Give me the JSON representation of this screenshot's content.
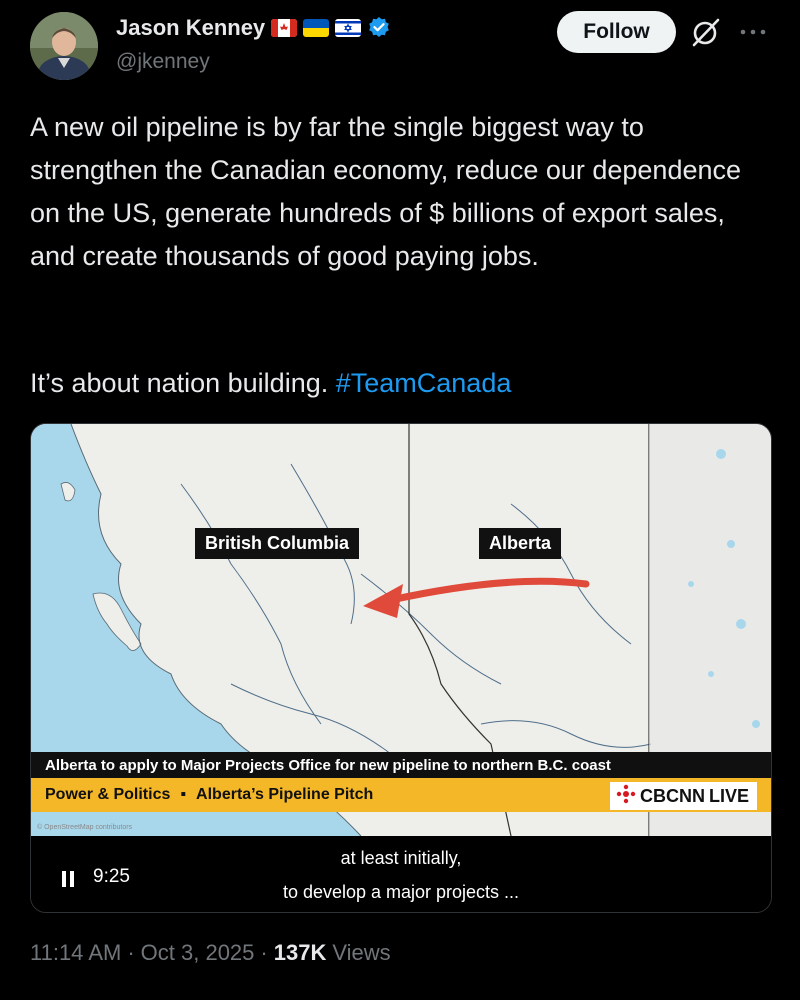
{
  "author": {
    "name": "Jason Kenney",
    "handle": "@jkenney",
    "flags": [
      "canada-flag",
      "ukraine-flag",
      "israel-flag"
    ],
    "verified_icon": "verified-badge-icon"
  },
  "actions": {
    "follow_label": "Follow",
    "grok_icon": "grok-icon",
    "more_icon": "more-icon"
  },
  "tweet": {
    "text": "A new oil pipeline is by far the single biggest way to strengthen the Canadian economy, reduce our dependence on the US, generate hundreds of $ billions of export sales, and create thousands of good paying jobs.",
    "line2_prefix": "It’s about nation building. ",
    "hashtag": "#TeamCanada"
  },
  "media": {
    "map_labels": {
      "bc": "British Columbia",
      "alberta": "Alberta"
    },
    "headline": "Alberta to apply to Major Projects Office for new pipeline to northern B.C. coast",
    "ticker_show": "Power & Politics",
    "ticker_separator": "▪",
    "ticker_topic": "Alberta’s Pipeline Pitch",
    "network": "CBCNN",
    "live": "LIVE",
    "osm_credit": "© OpenStreetMap contributors",
    "player": {
      "state_icon": "pause-icon",
      "time": "9:25"
    },
    "captions": [
      "at least initially,",
      "to develop a major projects ..."
    ]
  },
  "meta": {
    "time": "11:14 AM",
    "sep1": "·",
    "date": "Oct 3, 2025",
    "sep2": "·",
    "views_count": "137K",
    "views_label": "Views"
  },
  "colors": {
    "background": "#000000",
    "link": "#1d9bf0",
    "secondary_text": "#71767b",
    "ticker_yellow": "#f4b728",
    "cbc_red": "#d71920",
    "arrow_red": "#e04a3a"
  }
}
